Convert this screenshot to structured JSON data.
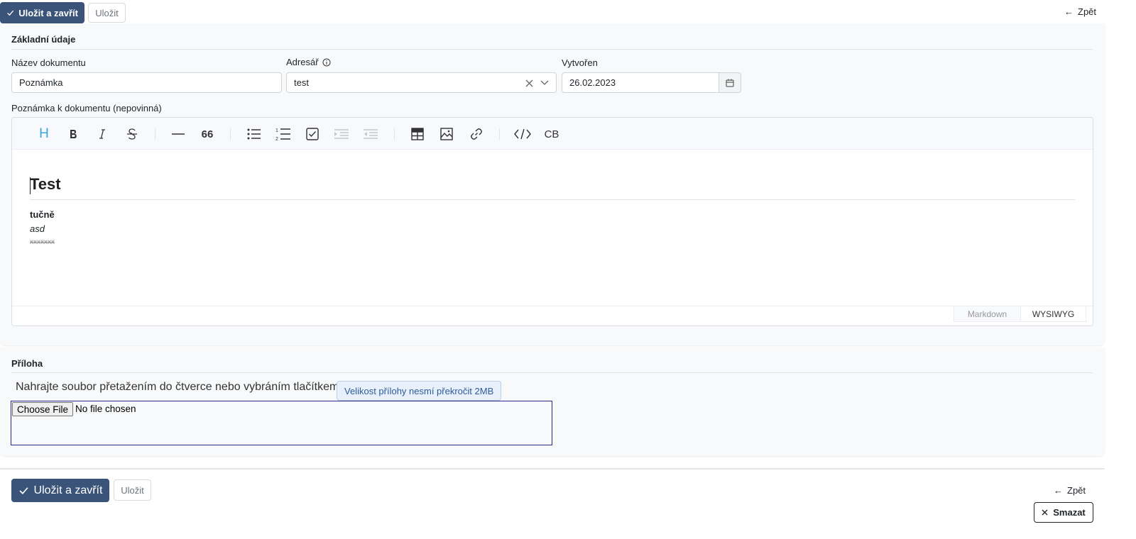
{
  "toolbar_top": {
    "save_close_label": "Uložit a zavřít",
    "save_label": "Uložit",
    "back_label": "Zpět"
  },
  "basic": {
    "section_title": "Základní údaje",
    "name_label": "Název dokumentu",
    "name_value": "Poznámka",
    "directory_label": "Adresář",
    "directory_value": "test",
    "created_label": "Vytvořen",
    "created_value": "26.02.2023",
    "note_label": "Poznámka k dokumentu (nepovinná)"
  },
  "editor": {
    "toolbar_icons": [
      "heading-icon",
      "bold-icon",
      "italic-icon",
      "strike-icon",
      "hr-icon",
      "quote-icon",
      "bullet-list-icon",
      "ordered-list-icon",
      "task-list-icon",
      "indent-icon",
      "outdent-icon",
      "table-icon",
      "image-icon",
      "link-icon",
      "code-icon",
      "code-block-icon"
    ],
    "code_block_text": "CB",
    "heading_text": "Test",
    "bold_text": "tučně",
    "italic_text": "asd",
    "strike_text": "xxxxxxx",
    "mode_markdown": "Markdown",
    "mode_wysiwyg": "WYSIWYG",
    "active_mode": "WYSIWYG"
  },
  "attachment": {
    "section_title": "Příloha",
    "upload_hint": "Nahrajte soubor přetažením do čtverce nebo vybráním tlačítkem",
    "size_badge": "Velikost přílohy nesmí překročit 2MB",
    "choose_file_label": "Choose File",
    "no_file_text": "No file chosen"
  },
  "toolbar_bottom": {
    "save_close_label": "Uložit a zavřít",
    "save_label": "Uložit",
    "back_label": "Zpět",
    "delete_label": "Smazat"
  },
  "colors": {
    "primary": "#3a5479",
    "heading_icon_active": "#3aa5d8",
    "badge_text": "#2d5b9a"
  }
}
